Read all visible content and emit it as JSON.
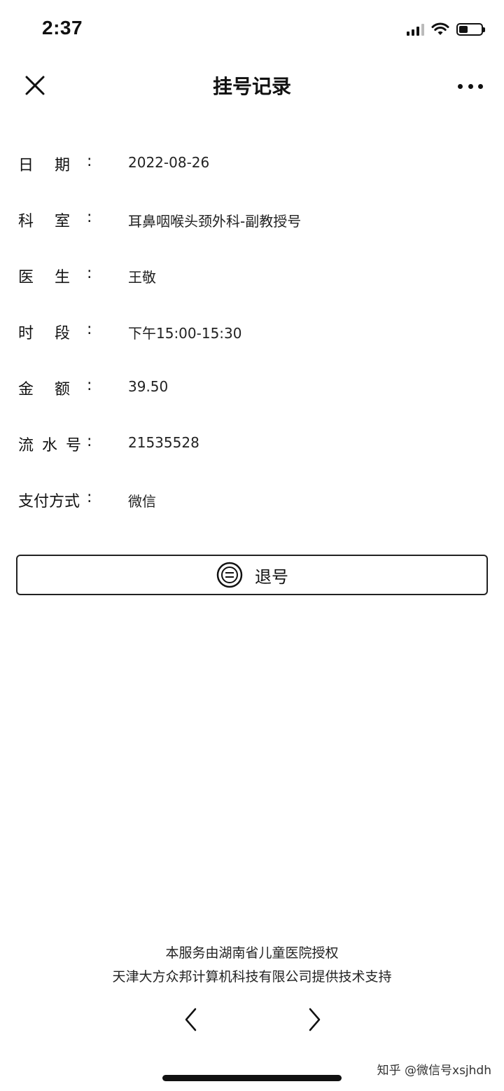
{
  "status_bar": {
    "time": "2:37",
    "icons": [
      "signal-icon",
      "wifi-icon",
      "battery-icon"
    ]
  },
  "nav": {
    "title": "挂号记录",
    "close_icon": "close-icon",
    "more_icon": "more-icon"
  },
  "details": [
    {
      "label_chars": [
        "日",
        "期"
      ],
      "colon": ":",
      "value": "2022-08-26"
    },
    {
      "label_chars": [
        "科",
        "室"
      ],
      "colon": ":",
      "value": "耳鼻咽喉头颈外科-副教授号"
    },
    {
      "label_chars": [
        "医",
        "生"
      ],
      "colon": ":",
      "value": "王敬"
    },
    {
      "label_chars": [
        "时",
        "段"
      ],
      "colon": ":",
      "value": "下午15:00-15:30"
    },
    {
      "label_chars": [
        "金",
        "额"
      ],
      "colon": ":",
      "value": "39.50"
    },
    {
      "label_chars": [
        "流",
        "水",
        "号"
      ],
      "colon": ":",
      "value": "21535528"
    },
    {
      "label_chars": [
        "支付方式"
      ],
      "colon": ":",
      "value": "微信"
    }
  ],
  "cancel_button": {
    "label": "退号",
    "icon": "cancel-circle-icon"
  },
  "footer": {
    "line1": "本服务由湖南省儿童医院授权",
    "line2": "天津大方众邦计算机科技有限公司提供技术支持"
  },
  "watermark": "知乎 @微信号xsjhdh"
}
